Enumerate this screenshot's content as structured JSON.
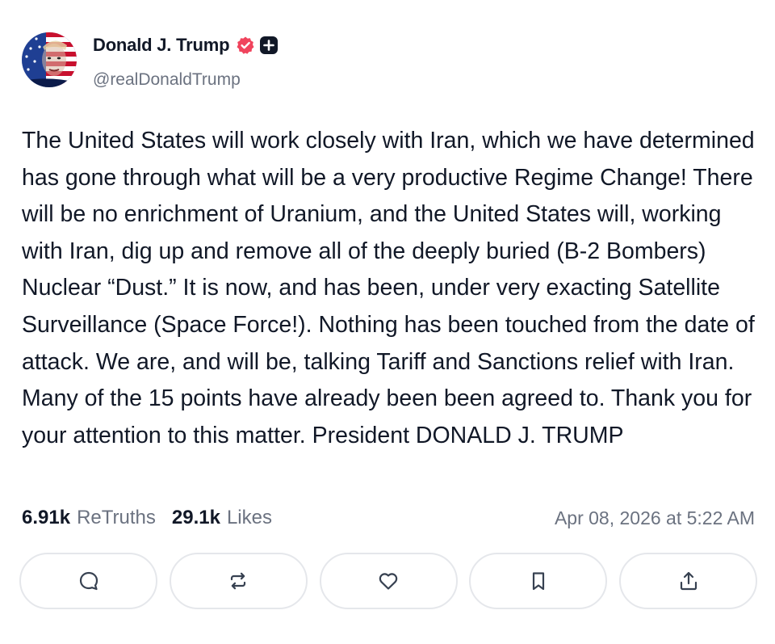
{
  "post": {
    "author": {
      "display_name": "Donald J. Trump",
      "handle": "@realDonaldTrump",
      "verified": true,
      "avatar_icon": "flag-portrait-avatar"
    },
    "text": "The United States will work closely with Iran, which we have determined has gone through what will be a very productive Regime Change! There will be no enrichment of Uranium, and the United States will, working with Iran, dig up and remove all of the deeply buried (B-2 Bombers) Nuclear “Dust.” It is now, and has been, under very exacting Satellite Surveillance (Space Force!). Nothing has been touched from the date of attack. We are, and will be, talking Tariff and Sanctions relief with Iran. Many of the 15 points have already been been agreed to. Thank you for your attention to this matter. President DONALD J. TRUMP",
    "stats": {
      "retruths_count": "6.91k",
      "retruths_label": "ReTruths",
      "likes_count": "29.1k",
      "likes_label": "Likes"
    },
    "timestamp": "Apr 08, 2026 at 5:22 AM",
    "actions": [
      {
        "name": "reply",
        "icon": "comment-icon"
      },
      {
        "name": "retruth",
        "icon": "repost-icon"
      },
      {
        "name": "like",
        "icon": "heart-icon"
      },
      {
        "name": "bookmark",
        "icon": "bookmark-icon"
      },
      {
        "name": "share",
        "icon": "share-icon"
      }
    ]
  },
  "colors": {
    "text_primary": "#111827",
    "text_secondary": "#6b7280",
    "verified_badge": "#f0445d",
    "button_border": "#e5e7eb"
  }
}
